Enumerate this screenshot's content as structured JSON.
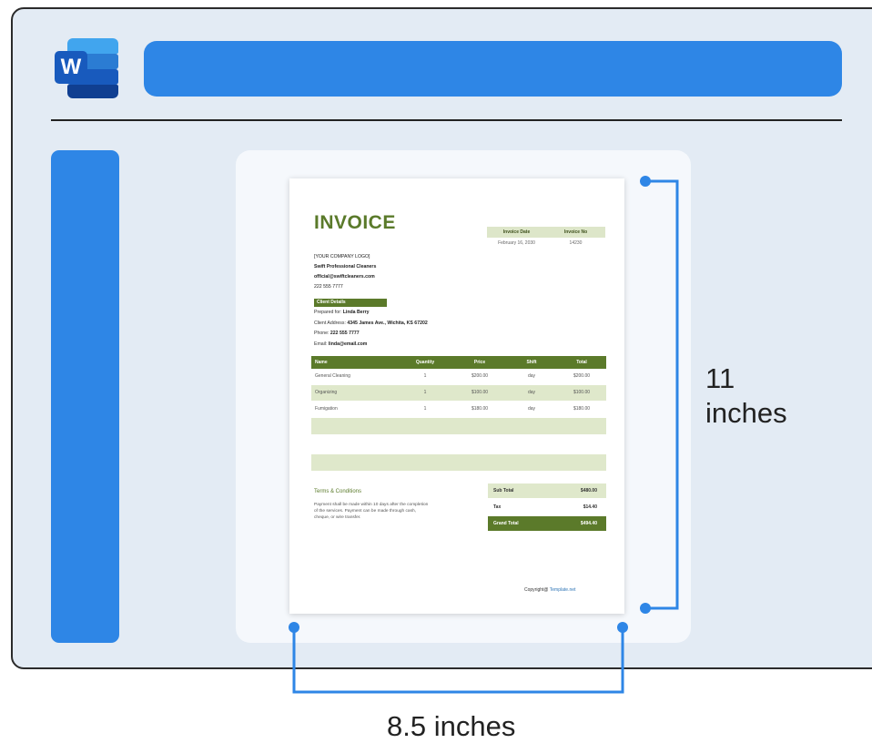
{
  "app": {
    "logo_letter": "W",
    "logo_name": "microsoft-word-icon"
  },
  "document": {
    "title": "INVOICE",
    "meta_headers": [
      "Invoice Date",
      "Invoice No"
    ],
    "meta_values": [
      "February 16, 2030",
      "14230"
    ],
    "company": [
      "[YOUR COMPANY LOGO]",
      "Swift Professional Cleaners",
      "official@swiftcleaners.com",
      "222 555 7777"
    ],
    "client_heading": "Client Details",
    "client_lines": [
      {
        "label": "Prepared for: ",
        "value": "Linda Berry"
      },
      {
        "label": "Client Address: ",
        "value": "4345 James Ave., Wichita, KS 67202"
      },
      {
        "label": "Phone: ",
        "value": "222 555 7777"
      },
      {
        "label": "Email: ",
        "value": "linda@email.com"
      }
    ],
    "table_headers": [
      "Name",
      "Quantity",
      "Price",
      "Shift",
      "Total"
    ],
    "table_rows": [
      [
        "General Cleaning",
        "1",
        "$200.00",
        "day",
        "$200.00"
      ],
      [
        "Organizing",
        "1",
        "$100.00",
        "day",
        "$100.00"
      ],
      [
        "Fumigation",
        "1",
        "$180.00",
        "day",
        "$180.00"
      ]
    ],
    "terms_title": "Terms & Conditions",
    "terms_text": "Payment shall be made within 10 days after the completion of the services. Payment can be made through cash, cheque, or wire transfer.",
    "totals": [
      {
        "label": "Sub Total",
        "value": "$480.00"
      },
      {
        "label": "Tax",
        "value": "$14.40"
      },
      {
        "label": "Grand Total",
        "value": "$494.40"
      }
    ],
    "copyright_prefix": "Copyright@ ",
    "copyright_link": "Template.net"
  },
  "dimensions": {
    "height": "11\ninches",
    "width": "8.5 inches"
  },
  "colors": {
    "accent": "#2e86e6",
    "invoice_green": "#5b7a2a",
    "light_green": "#dfe8cb"
  }
}
